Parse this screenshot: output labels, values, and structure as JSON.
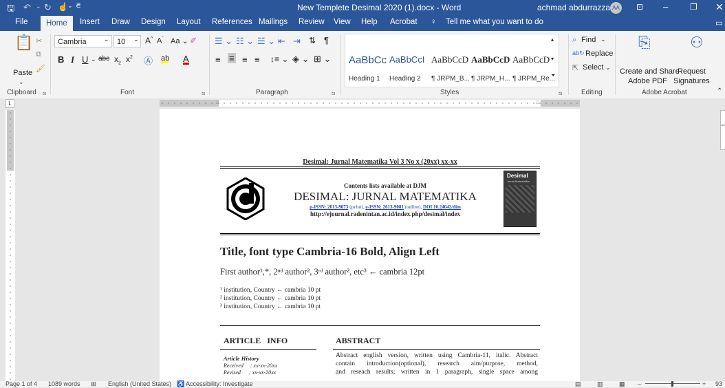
{
  "window": {
    "title": "New Templete Desimal 2020 (1).docx  -  Word",
    "user_name": "achmad abdurrazzaq",
    "user_initials": "AA"
  },
  "tabs": [
    "File",
    "Home",
    "Insert",
    "Draw",
    "Design",
    "Layout",
    "References",
    "Mailings",
    "Review",
    "View",
    "Help",
    "Acrobat"
  ],
  "tell_me": "Tell me what you want to do",
  "ribbon": {
    "clipboard": {
      "paste": "Paste",
      "label": "Clipboard"
    },
    "font": {
      "name": "Cambria",
      "size": "10",
      "label": "Font"
    },
    "paragraph": {
      "label": "Paragraph"
    },
    "styles": {
      "label": "Styles",
      "items": [
        {
          "preview": "AaBbCc",
          "name": "Heading 1"
        },
        {
          "preview": "AaBbCcI",
          "name": "Heading 2"
        },
        {
          "preview": "AaBbCcD",
          "name": "¶ JRPM_B..."
        },
        {
          "preview": "AaBbCcD",
          "name": "¶ JRPM_H..."
        },
        {
          "preview": "AaBbCcD",
          "name": "¶ JRPM_Re..."
        }
      ]
    },
    "editing": {
      "find": "Find",
      "replace": "Replace",
      "select": "Select",
      "label": "Editing"
    },
    "acrobat": {
      "create_share_1": "Create and Share",
      "create_share_2": "Adobe PDF",
      "request_1": "Request",
      "request_2": "Signatures",
      "label": "Adobe Acrobat"
    }
  },
  "document": {
    "header": "Desimal: Jurnal Matematika Vol 3 No x (20xx) xx-xx",
    "contents_line": "Contents lists available at DJM",
    "journal_name": "DESIMAL: JURNAL MATEMATIKA",
    "pissn": "p-ISSN: 2613-9073",
    "print": "(print),",
    "eissn": "e-ISSN: 2613-9081",
    "online": "(online),",
    "doi": "DOI 10.24042/dim",
    "url": "http://ejournal.radenintan.ac.id/index.php/desimal/index",
    "cover_title": "Desimal",
    "cover_subtitle": "Jurnal Matematika",
    "title": "Title, font type Cambria-16 Bold, Align Left",
    "authors": "First author¹,*, 2ⁿᵈ author², 3ʳᵈ author², etc³ ← cambria 12pt",
    "institutions": [
      "¹ institution, Country ← cambria 10 pt",
      "² institution, Country ← cambria 10 pt",
      "³ institution, Country ← cambria 10 pt"
    ],
    "article_info": "ARTICLE   INFO",
    "article_history": "Article History",
    "received": "Received     : xx-xx-20xx",
    "revised": "Revised      : xx-xx-20xx",
    "abstract_heading": "ABSTRACT",
    "abstract_lines": [
      "Abstract english version, written using Cambria-11, italic. Abstract",
      "contain introduction(optional), research aim/purpose, method,",
      "and reseach results; written in 1 paragraph, single space among"
    ]
  },
  "status": {
    "page": "Page 1 of 4",
    "words": "1089 words",
    "language": "English (United States)",
    "accessibility": "Accessibility: Investigate",
    "zoom": "93"
  }
}
